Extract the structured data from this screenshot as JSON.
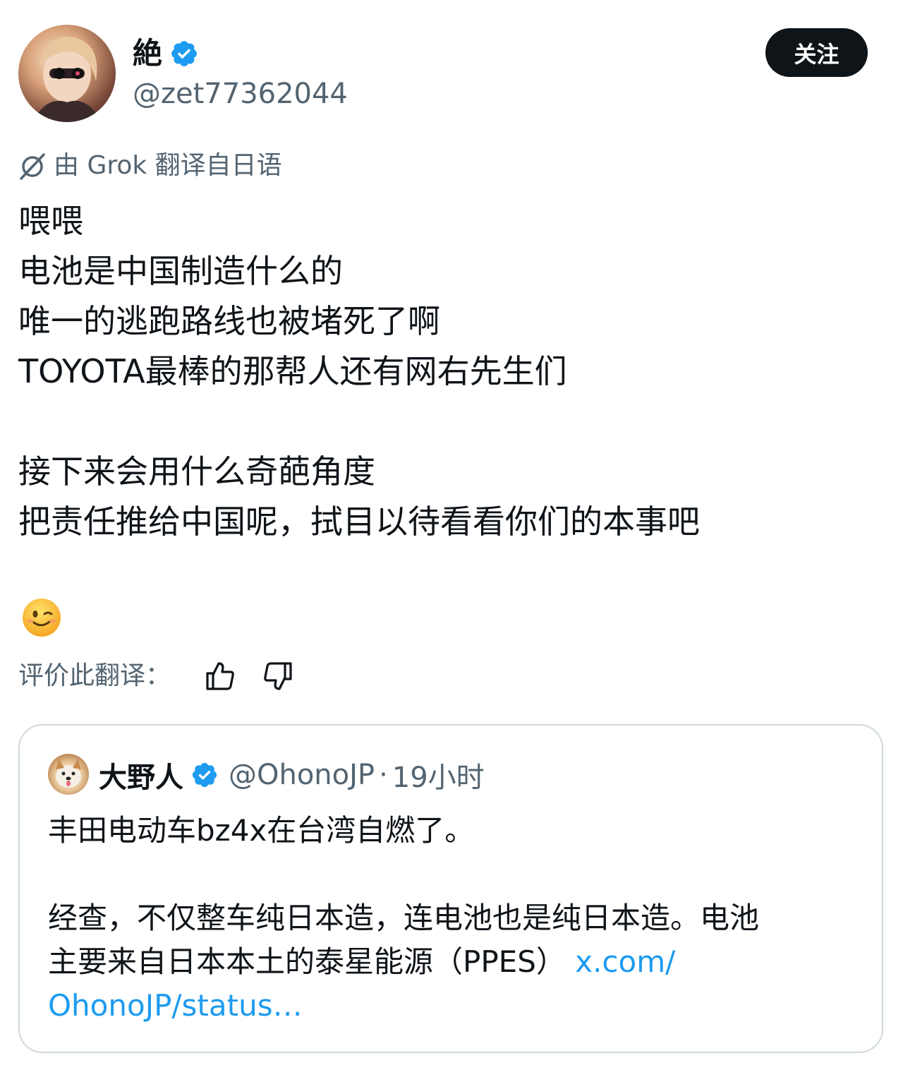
{
  "author": {
    "name": "絶",
    "handle": "@zet77362044",
    "follow_label": "关注"
  },
  "translation_note": "由 Grok 翻译自日语",
  "tweet_lines": [
    "喂喂",
    "电池是中国制造什么的",
    "唯一的逃跑路线也被堵死了啊",
    "TOYOTA最棒的那帮人还有网右先生们",
    "",
    "接下来会用什么奇葩角度",
    "把责任推给中国呢，拭目以待看看你们的本事吧"
  ],
  "emoji": "winking-face",
  "rate": {
    "label": "评价此翻译："
  },
  "quote": {
    "name": "大野人",
    "handle": "@OhonoJP",
    "dot": "·",
    "time": "19小时",
    "line1": "丰田电动车bz4x在台湾自燃了。",
    "line2": "经查，不仅整车纯日本造，连电池也是纯日本造。电池",
    "line3_text": "主要来自日本本土的泰星能源（PPES）",
    "line3_link": "x.com/",
    "line4_link": "OhonoJP/status…"
  },
  "colors": {
    "text": "#0f1419",
    "secondary": "#536471",
    "link": "#1d9bf0",
    "verified": "#1d9bf0",
    "border": "#cfd9de"
  }
}
